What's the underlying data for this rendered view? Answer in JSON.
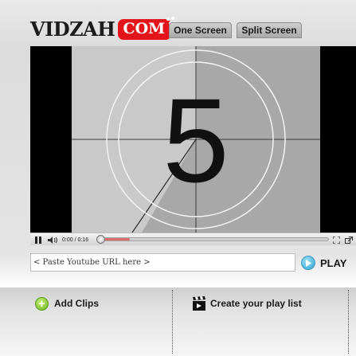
{
  "header": {
    "logo_text": "VIDZAH",
    "logo_com": "COM",
    "tabs": [
      {
        "label": "One Screen"
      },
      {
        "label": "Split Screen"
      }
    ]
  },
  "video": {
    "countdown_number": "5",
    "time_display": "0:00 / 0:16",
    "buffered_fraction": 0.13,
    "played_fraction": 0.0
  },
  "url_bar": {
    "placeholder": "< Paste Youtube URL here >",
    "play_label": "PLAY"
  },
  "bottom": {
    "add_clips_label": "Add Clips",
    "playlist_label": "Create your play list"
  },
  "colors": {
    "brand_red": "#e3151a",
    "play_blue": "#2ba3d3",
    "add_green": "#6bb21a"
  },
  "icons": [
    "pause-icon",
    "volume-icon",
    "fullscreen-icon",
    "external-icon",
    "play-icon",
    "plus-icon",
    "clapperboard-icon"
  ]
}
